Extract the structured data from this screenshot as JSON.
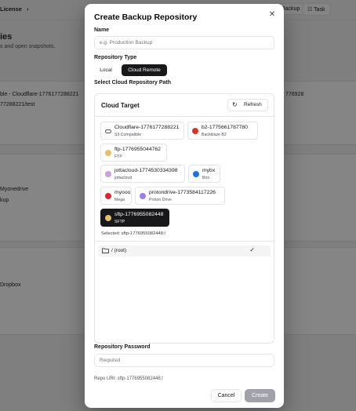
{
  "background": {
    "breadcrumb": "License",
    "header_chevron": "›",
    "heading": "ies",
    "subtitle": "s and open snapshots.",
    "backup_tab": "Backup",
    "task_tab": "Task",
    "row1_name": "ble - Cloudflare-1776177288221",
    "row1_path": "77288221/test",
    "row1_right": "776928",
    "row2_name": "Myonedrive",
    "row2_path": "kup",
    "row3_name": "Dropbox"
  },
  "dialog": {
    "title": "Create Backup Repository",
    "close_glyph": "✕",
    "name_label": "Name",
    "name_placeholder": "e.g. Production Backup",
    "name_value": "",
    "type_label": "Repository Type",
    "type_options": [
      "Local",
      "Cloud Remote"
    ],
    "type_selected": "Cloud Remote",
    "path_label": "Select Cloud Repository Path",
    "panel_title": "Cloud Target",
    "refresh_label": "Refresh",
    "remotes": [
      {
        "name": "Cloudflare-1776177288221",
        "type": "S3 Compatible",
        "icon": "cloud-icon",
        "color": "#ffffff"
      },
      {
        "name": "b2-1775661787780",
        "type": "Backblaze B2",
        "icon": "backblaze-icon",
        "color": "#d9342b"
      },
      {
        "name": "ftp-1776955044762",
        "type": "FTP",
        "icon": "ftp-icon",
        "color": "#e2c16a"
      },
      {
        "name": "jottacloud-1774530334398",
        "type": "jottacloud",
        "icon": "jottacloud-icon",
        "color": "#c9a0dc"
      },
      {
        "name": "mybx",
        "type": "Box",
        "icon": "box-icon",
        "color": "#1a73e8"
      },
      {
        "name": "myooo",
        "type": "Mega",
        "icon": "mega-icon",
        "color": "#d9272e"
      },
      {
        "name": "protondrive-1773584117226",
        "type": "Proton Drive",
        "icon": "proton-icon",
        "color": "#9b7fe0"
      },
      {
        "name": "sftp-1776955082448",
        "type": "SFTP",
        "icon": "sftp-icon",
        "color": "#e2c16a"
      }
    ],
    "selected_remote": "sftp-1776955082448",
    "selected_text": "Selected: sftp-1776955082448:/",
    "root_label": "/ (root)",
    "check_glyph": "✓",
    "password_label": "Repository Password",
    "password_placeholder": "Required",
    "repo_uri": "Repo URI: sftp-1776955082448:/",
    "cancel_label": "Cancel",
    "create_label": "Create"
  }
}
